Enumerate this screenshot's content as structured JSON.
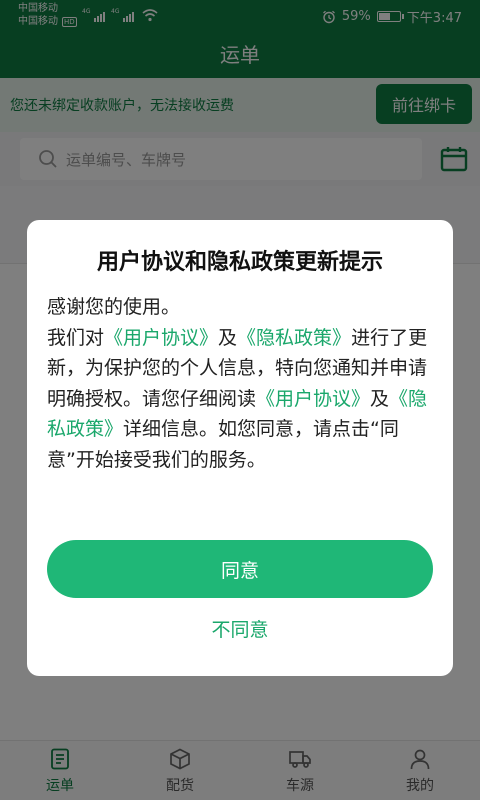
{
  "status_bar": {
    "carrier1": "中国移动",
    "carrier2": "中国移动",
    "hd": "HD",
    "signal_tag1": "4G",
    "signal_tag2": "4G",
    "battery_percent": "59%",
    "time": "下午3:47",
    "battery_level": 0.59
  },
  "header": {
    "title": "运单"
  },
  "notice": {
    "text": "您还未绑定收款账户，无法接收运费",
    "button": "前往绑卡"
  },
  "search": {
    "placeholder": "运单编号、车牌号"
  },
  "bottom_nav": [
    {
      "label": "运单",
      "icon": "waybill-icon",
      "active": true
    },
    {
      "label": "配货",
      "icon": "box-icon",
      "active": false
    },
    {
      "label": "车源",
      "icon": "truck-icon",
      "active": false
    },
    {
      "label": "我的",
      "icon": "user-icon",
      "active": false
    }
  ],
  "dialog": {
    "title": "用户协议和隐私政策更新提示",
    "line1": "感谢您的使用。",
    "p2_a": "我们对",
    "link_user_agreement": "《用户协议》",
    "p2_b": "及",
    "link_privacy_policy": "《隐私政策》",
    "p2_c": "进行了更新，为保护您的个人信息，特向您通知并申请明确授权。请您仔细阅读",
    "link_user_agreement_2": "《用户协议》",
    "p2_d": "及",
    "link_privacy_policy_2": "《隐私政策》",
    "p2_e": "详细信息。如您同意，请点击“同意”开始接受我们的服务。",
    "agree": "同意",
    "disagree": "不同意"
  },
  "colors": {
    "brand_green": "#0e7c42",
    "button_green": "#1fb777",
    "link_green": "#1aa76b"
  }
}
